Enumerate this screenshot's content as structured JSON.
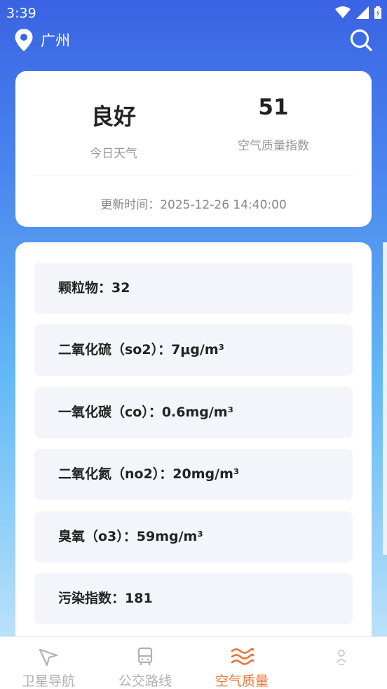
{
  "status_bar": {
    "time": "3:39"
  },
  "header": {
    "city": "广州"
  },
  "summary": {
    "level": "良好",
    "level_label": "今日天气",
    "index": "51",
    "index_label": "空气质量指数",
    "update_label": "更新时间：2025-12-26 14:40:00"
  },
  "pollutants": [
    {
      "label": "颗粒物：32"
    },
    {
      "label": "二氧化硫（so2）：7μg/m³"
    },
    {
      "label": "一氧化碳（co）：0.6mg/m³"
    },
    {
      "label": "二氧化氮（no2）：20mg/m³"
    },
    {
      "label": "臭氧（o3）：59mg/m³"
    },
    {
      "label": "污染指数：181"
    }
  ],
  "tabs": [
    {
      "label": "卫星导航",
      "icon": "navigation-icon",
      "active": false
    },
    {
      "label": "公交路线",
      "icon": "bus-icon",
      "active": false
    },
    {
      "label": "空气质量",
      "icon": "air-waves-icon",
      "active": true
    },
    {
      "label": "",
      "icon": "profile-icon",
      "active": false
    }
  ],
  "colors": {
    "accent": "#e8773a",
    "header_gradient_top": "#3a63e3",
    "card_item_bg": "#f4f5fa"
  }
}
